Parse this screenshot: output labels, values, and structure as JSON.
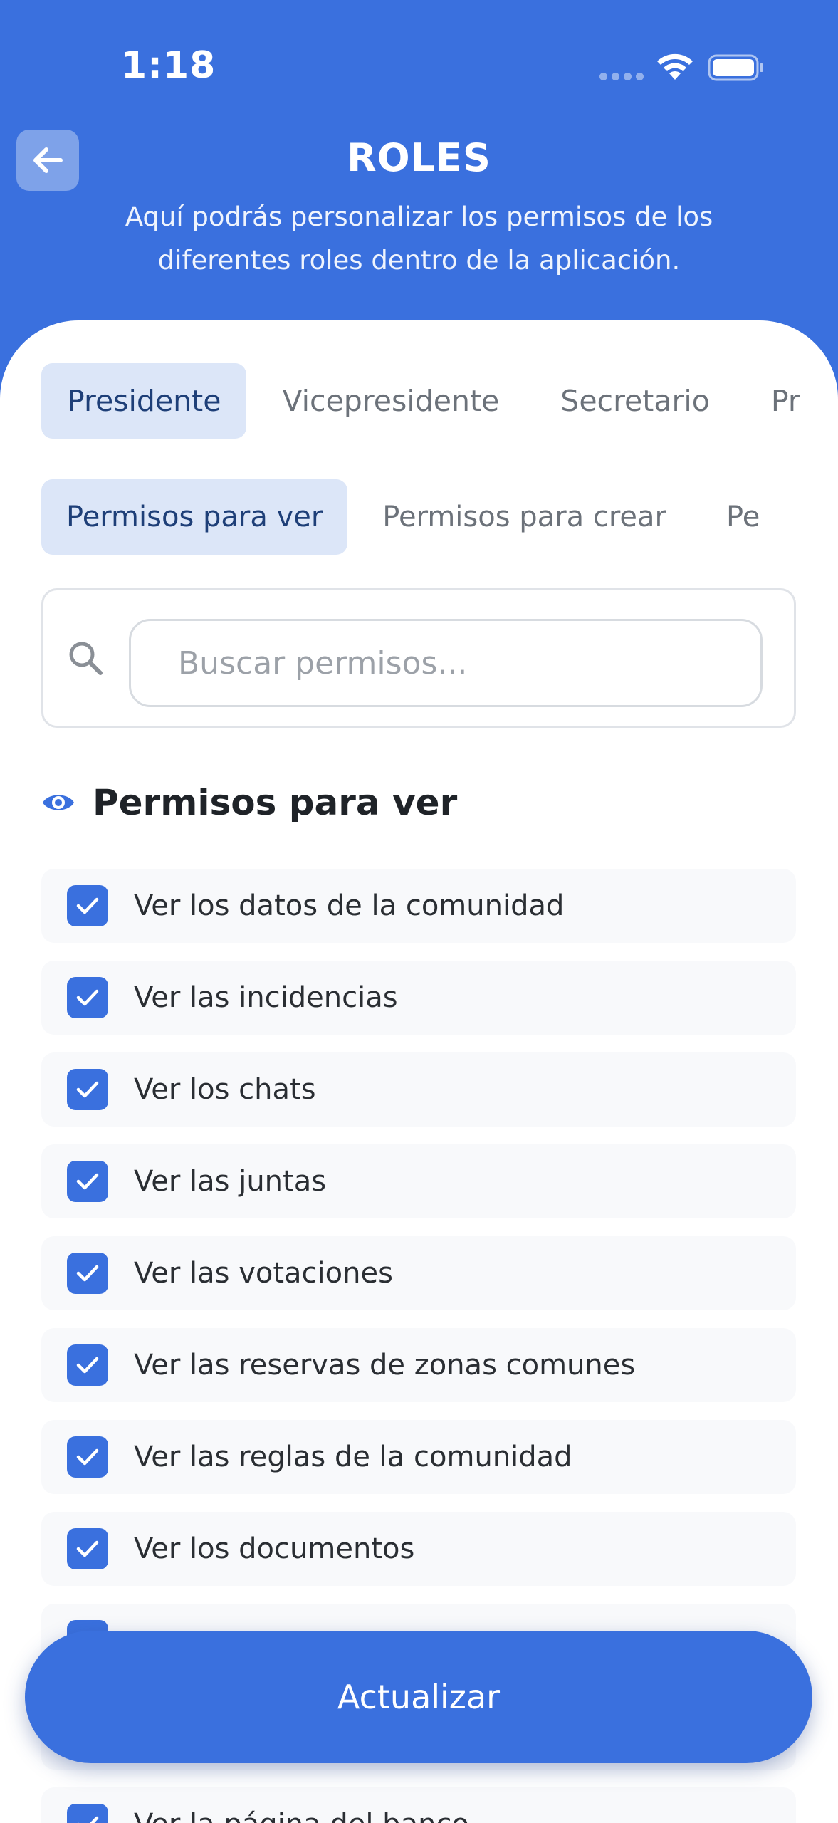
{
  "status_bar": {
    "time": "1:18"
  },
  "header": {
    "title": "ROLES",
    "subtitle": "Aquí podrás personalizar los permisos de los diferentes roles dentro de la aplicación."
  },
  "roles_tabs": [
    {
      "label": "Presidente",
      "active": true
    },
    {
      "label": "Vicepresidente",
      "active": false
    },
    {
      "label": "Secretario",
      "active": false
    },
    {
      "label": "Pr",
      "active": false
    }
  ],
  "permission_tabs": [
    {
      "label": "Permisos para ver",
      "active": true
    },
    {
      "label": "Permisos para crear",
      "active": false
    },
    {
      "label": "Pe",
      "active": false
    }
  ],
  "search": {
    "placeholder": "Buscar permisos...",
    "value": ""
  },
  "section": {
    "title": "Permisos para ver",
    "icon": "eye-icon"
  },
  "permissions": [
    {
      "label": "Ver los datos de la comunidad",
      "checked": true
    },
    {
      "label": "Ver las incidencias",
      "checked": true
    },
    {
      "label": "Ver los chats",
      "checked": true
    },
    {
      "label": "Ver las juntas",
      "checked": true
    },
    {
      "label": "Ver las votaciones",
      "checked": true
    },
    {
      "label": "Ver las reservas de zonas comunes",
      "checked": true
    },
    {
      "label": "Ver las reglas de la comunidad",
      "checked": true
    },
    {
      "label": "Ver los documentos",
      "checked": true
    },
    {
      "label": "",
      "checked": true
    },
    {
      "label": "",
      "checked": true
    },
    {
      "label": "Ver la página del banco",
      "checked": true
    }
  ],
  "footer": {
    "update_label": "Actualizar"
  },
  "colors": {
    "primary": "#3A70DE",
    "tab_active_bg": "#DCE6F8",
    "tab_active_text": "#1E3F78"
  }
}
